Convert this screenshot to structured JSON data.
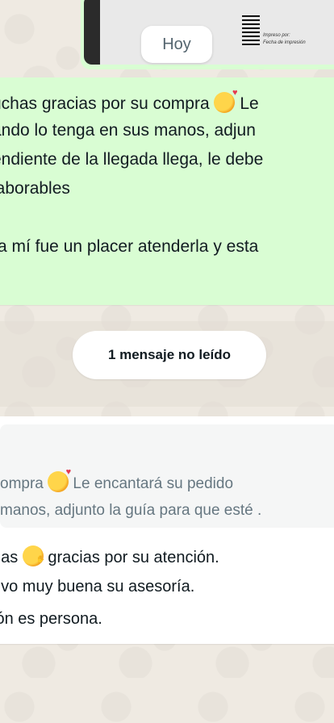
{
  "date_divider": {
    "label": "Hoy"
  },
  "image_message": {
    "receipt_lines": [
      "Impreso por:",
      "Fecha de impresión"
    ]
  },
  "outgoing_message": {
    "lines": [
      "uchas gracias por su compra",
      "Le",
      "ando lo tenga en sus manos, adjun",
      "endiente de la llegada  llega, le debe",
      "laborables",
      "ra mí fue un placer atenderla y esta"
    ],
    "emoji": "smiling-face-with-hearts"
  },
  "unread_divider": {
    "label": "1 mensaje no leído"
  },
  "incoming_message": {
    "quote_lines": [
      "ompra",
      "Le encantará su pedido",
      "manos, adjunto la guía para que esté ."
    ],
    "body_lines": [
      "nas",
      "gracias por su atención.",
      "uvo muy buena su asesoría.",
      "ión es persona."
    ],
    "quote_emoji": "smiling-face-with-hearts",
    "body_emoji": "hugging-face"
  }
}
